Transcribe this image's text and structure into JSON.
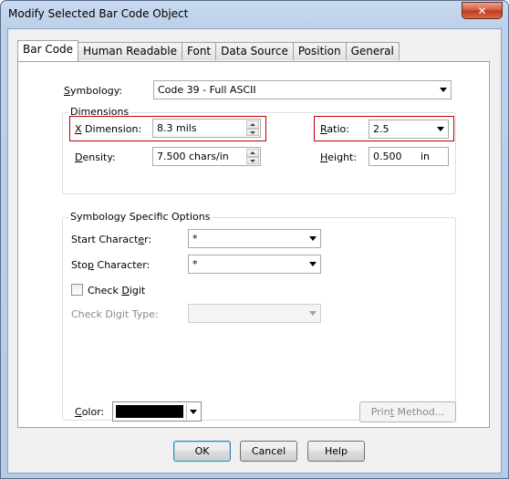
{
  "window": {
    "title": "Modify Selected Bar Code Object",
    "close_glyph": "✕"
  },
  "tabs": [
    "Bar Code",
    "Human Readable",
    "Font",
    "Data Source",
    "Position",
    "General"
  ],
  "symbology": {
    "label_u": "S",
    "label_rest": "ymbology:",
    "value": "Code 39 - Full ASCII"
  },
  "dimensions": {
    "title": "Dimensions",
    "x_dimension": {
      "label_u": "X",
      "label_rest": " Dimension:",
      "value": "8.3  mils"
    },
    "density": {
      "label_u": "D",
      "label_rest": "ensity:",
      "value": "7.500  chars/in"
    },
    "ratio": {
      "label_u": "R",
      "label_rest": "atio:",
      "value": "2.5"
    },
    "height": {
      "label_u": "H",
      "label_rest": "eight:",
      "value": "0.500",
      "unit": "in"
    }
  },
  "symbology_options": {
    "title": "Symbology Specific Options",
    "start_character": {
      "label_pre": "Start Charact",
      "label_u": "e",
      "label_post": "r:",
      "value": "*"
    },
    "stop_character": {
      "label_pre": "Sto",
      "label_u": "p",
      "label_post": " Character:",
      "value": "*"
    },
    "check_digit": {
      "label_pre": "Check ",
      "label_u": "D",
      "label_post": "igit",
      "checked": false
    },
    "check_digit_type": {
      "label": "Check Digit Type:",
      "value": ""
    }
  },
  "color": {
    "label_u": "C",
    "label_rest": "olor:",
    "value": "#000000"
  },
  "buttons": {
    "print_method_pre": "Prin",
    "print_method_u": "t",
    "print_method_post": " Method...",
    "ok": "OK",
    "cancel": "Cancel",
    "help": "Help"
  },
  "colors": {
    "highlight": "#c00000",
    "title_bar": "#bcd1ea",
    "close_button": "#c33818"
  }
}
